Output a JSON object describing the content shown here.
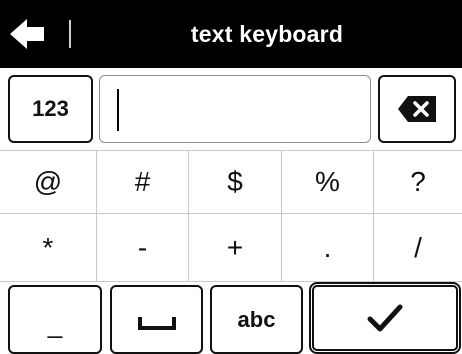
{
  "header": {
    "title": "text keyboard",
    "back_icon": "back-arrow-icon"
  },
  "input": {
    "value": ""
  },
  "keys": {
    "mode_numbers": "123",
    "backspace_icon": "backspace-icon",
    "underscore": "_",
    "space_icon": "space-bar-icon",
    "mode_letters": "abc",
    "confirm_icon": "checkmark-icon"
  },
  "symbol_rows": [
    [
      "@",
      "#",
      "$",
      "%",
      "?"
    ],
    [
      "*",
      "-",
      "+",
      ".",
      "/"
    ]
  ],
  "colors": {
    "header_bg": "#000000",
    "header_text": "#ffffff",
    "key_border": "#111111",
    "grid_lines": "#c8c8c8"
  }
}
